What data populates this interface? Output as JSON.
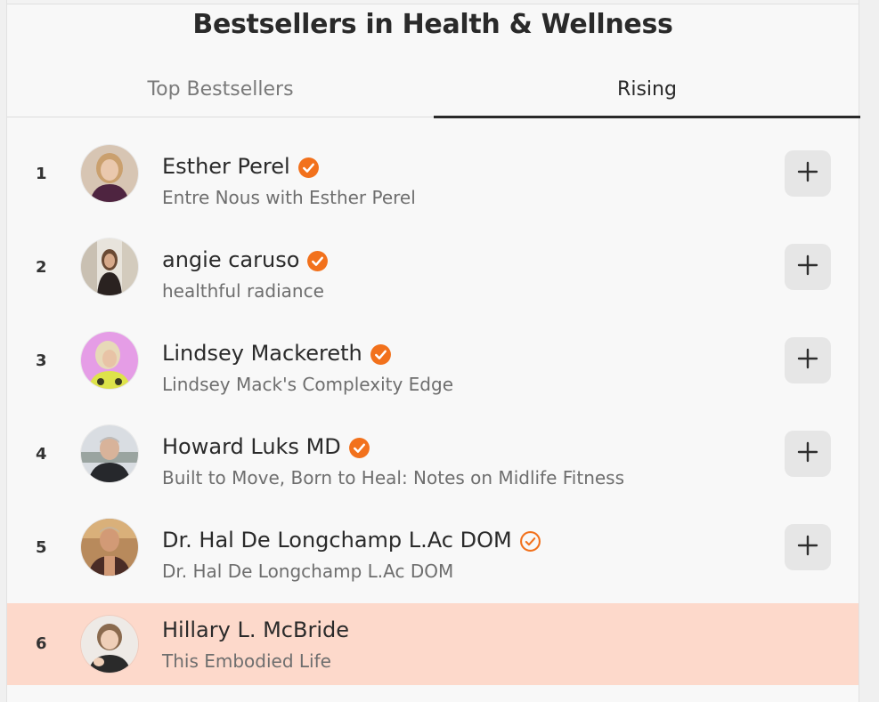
{
  "page": {
    "title": "Bestsellers in Health & Wellness"
  },
  "tabs": [
    {
      "label": "Top Bestsellers",
      "active": false
    },
    {
      "label": "Rising",
      "active": true
    }
  ],
  "colors": {
    "accent": "#f2711c",
    "highlight_row": "#fdd9cb",
    "tab_underline": "#2a2a2a"
  },
  "list": [
    {
      "rank": "1",
      "name": "Esther Perel",
      "subtitle": "Entre Nous with Esther Perel",
      "badge": "verified-filled-icon",
      "action": "plus-icon"
    },
    {
      "rank": "2",
      "name": "angie caruso",
      "subtitle": "healthful radiance",
      "badge": "verified-filled-icon",
      "action": "plus-icon"
    },
    {
      "rank": "3",
      "name": "Lindsey Mackereth",
      "subtitle": "Lindsey Mack's Complexity Edge",
      "badge": "verified-filled-icon",
      "action": "plus-icon"
    },
    {
      "rank": "4",
      "name": "Howard Luks MD",
      "subtitle": "Built to Move, Born to Heal: Notes on Midlife Fitness",
      "badge": "verified-filled-icon",
      "action": "plus-icon"
    },
    {
      "rank": "5",
      "name": "Dr. Hal De Longchamp L.Ac DOM",
      "subtitle": "Dr. Hal De Longchamp L.Ac DOM",
      "badge": "verified-outline-icon",
      "action": "plus-icon"
    },
    {
      "rank": "6",
      "name": "Hillary L. McBride",
      "subtitle": "This Embodied Life",
      "highlighted": true
    }
  ]
}
